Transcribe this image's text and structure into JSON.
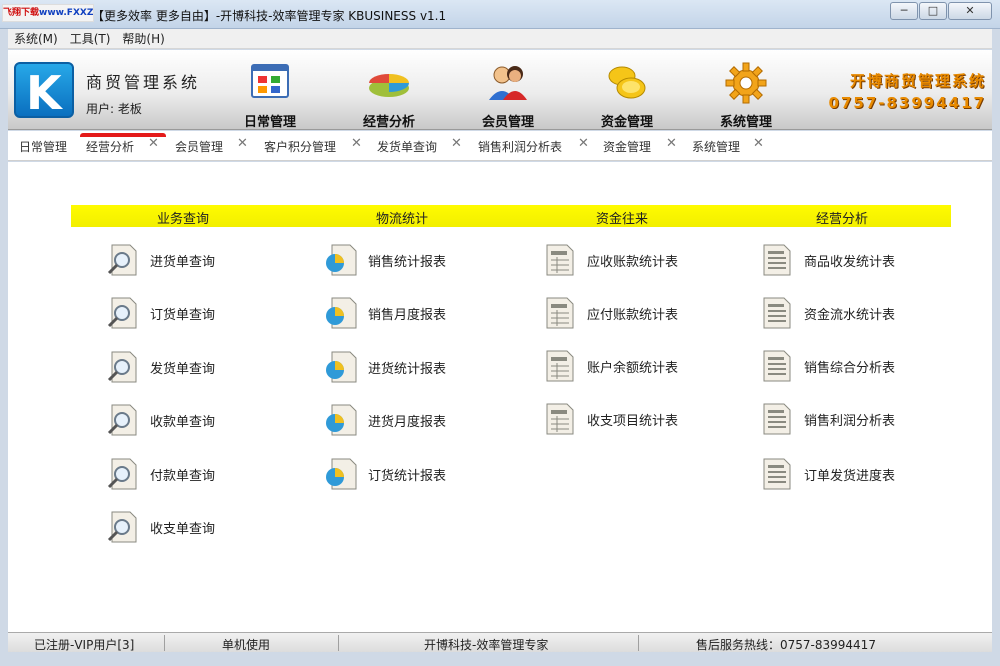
{
  "window": {
    "watermark_a": "飞翔下载",
    "watermark_b": "www.FXXZ.com",
    "title": "【更多效率 更多自由】-开博科技-效率管理专家  KBUSINESS v1.1",
    "minimize": "─",
    "maximize": "□",
    "close": "✕"
  },
  "menu": [
    "系统(M)",
    "工具(T)",
    "帮助(H)"
  ],
  "header": {
    "app_name": "商贸管理系统",
    "user": "用户: 老板",
    "promo_title": "开博商贸管理系统",
    "promo_phone": "0757-83994417"
  },
  "toolbar": [
    {
      "label": "日常管理",
      "icon": "window-grid-icon"
    },
    {
      "label": "经营分析",
      "icon": "pie-chart-icon"
    },
    {
      "label": "会员管理",
      "icon": "users-icon"
    },
    {
      "label": "资金管理",
      "icon": "coins-icon"
    },
    {
      "label": "系统管理",
      "icon": "gear-icon"
    }
  ],
  "tabs": [
    {
      "label": "日常管理",
      "closable": false,
      "active": false
    },
    {
      "label": "经营分析",
      "closable": true,
      "active": true
    },
    {
      "label": "会员管理",
      "closable": true,
      "active": false
    },
    {
      "label": "客户积分管理",
      "closable": true,
      "active": false
    },
    {
      "label": "发货单查询",
      "closable": true,
      "active": false
    },
    {
      "label": "销售利润分析表",
      "closable": true,
      "active": false
    },
    {
      "label": "资金管理",
      "closable": true,
      "active": false
    },
    {
      "label": "系统管理",
      "closable": true,
      "active": false
    }
  ],
  "tab_close_glyph": "✕",
  "categories": [
    {
      "title": "业务查询",
      "icon": "search-document-icon",
      "items": [
        "进货单查询",
        "订货单查询",
        "发货单查询",
        "收款单查询",
        "付款单查询",
        "收支单查询"
      ]
    },
    {
      "title": "物流统计",
      "icon": "pie-document-icon",
      "items": [
        "销售统计报表",
        "销售月度报表",
        "进货统计报表",
        "进货月度报表",
        "订货统计报表"
      ]
    },
    {
      "title": "资金往来",
      "icon": "ledger-document-icon",
      "items": [
        "应收账款统计表",
        "应付账款统计表",
        "账户余额统计表",
        "收支项目统计表"
      ]
    },
    {
      "title": "经营分析",
      "icon": "report-document-icon",
      "items": [
        "商品收发统计表",
        "资金流水统计表",
        "销售综合分析表",
        "销售利润分析表",
        "订单发货进度表"
      ]
    }
  ],
  "status": {
    "registered": "已注册-VIP用户[3]",
    "mode": "单机使用",
    "company": "开博科技-效率管理专家",
    "hotline": "售后服务热线：0757-83994417"
  },
  "colors": {
    "category_bar": "#fffb00",
    "active_tab": "#e41a1a",
    "promo": "#e88a00"
  }
}
